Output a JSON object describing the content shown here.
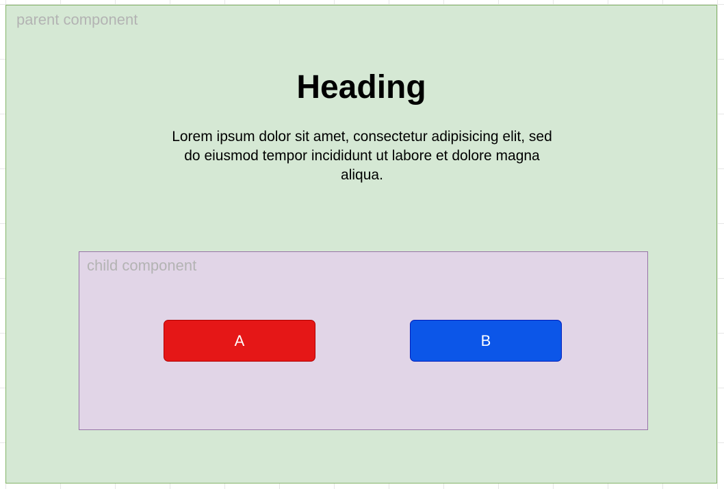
{
  "parent": {
    "label": "parent component",
    "heading": "Heading",
    "body": "Lorem ipsum dolor sit amet, consectetur adipisicing elit, sed do eiusmod tempor incididunt ut labore et dolore magna aliqua."
  },
  "child": {
    "label": "child component",
    "button_a": "A",
    "button_b": "B"
  },
  "colors": {
    "parent_fill": "#d5e8d4",
    "parent_border": "#82b366",
    "child_fill": "#e1d5e7",
    "child_border": "#9673a6",
    "button_a": "#e51717",
    "button_b": "#0c56e8"
  }
}
